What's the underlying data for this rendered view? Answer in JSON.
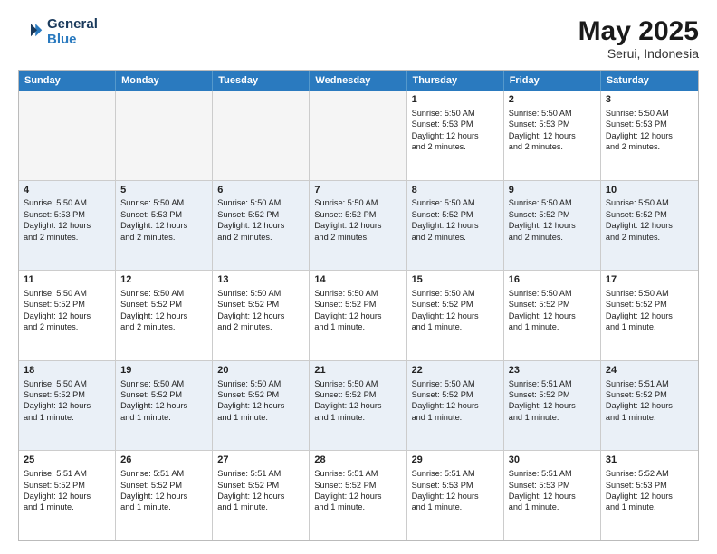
{
  "header": {
    "logo_line1": "General",
    "logo_line2": "Blue",
    "title": "May 2025",
    "subtitle": "Serui, Indonesia"
  },
  "days": [
    "Sunday",
    "Monday",
    "Tuesday",
    "Wednesday",
    "Thursday",
    "Friday",
    "Saturday"
  ],
  "weeks": [
    [
      {
        "day": "",
        "lines": []
      },
      {
        "day": "",
        "lines": []
      },
      {
        "day": "",
        "lines": []
      },
      {
        "day": "",
        "lines": []
      },
      {
        "day": "1",
        "lines": [
          "Sunrise: 5:50 AM",
          "Sunset: 5:53 PM",
          "Daylight: 12 hours",
          "and 2 minutes."
        ]
      },
      {
        "day": "2",
        "lines": [
          "Sunrise: 5:50 AM",
          "Sunset: 5:53 PM",
          "Daylight: 12 hours",
          "and 2 minutes."
        ]
      },
      {
        "day": "3",
        "lines": [
          "Sunrise: 5:50 AM",
          "Sunset: 5:53 PM",
          "Daylight: 12 hours",
          "and 2 minutes."
        ]
      }
    ],
    [
      {
        "day": "4",
        "lines": [
          "Sunrise: 5:50 AM",
          "Sunset: 5:53 PM",
          "Daylight: 12 hours",
          "and 2 minutes."
        ]
      },
      {
        "day": "5",
        "lines": [
          "Sunrise: 5:50 AM",
          "Sunset: 5:53 PM",
          "Daylight: 12 hours",
          "and 2 minutes."
        ]
      },
      {
        "day": "6",
        "lines": [
          "Sunrise: 5:50 AM",
          "Sunset: 5:52 PM",
          "Daylight: 12 hours",
          "and 2 minutes."
        ]
      },
      {
        "day": "7",
        "lines": [
          "Sunrise: 5:50 AM",
          "Sunset: 5:52 PM",
          "Daylight: 12 hours",
          "and 2 minutes."
        ]
      },
      {
        "day": "8",
        "lines": [
          "Sunrise: 5:50 AM",
          "Sunset: 5:52 PM",
          "Daylight: 12 hours",
          "and 2 minutes."
        ]
      },
      {
        "day": "9",
        "lines": [
          "Sunrise: 5:50 AM",
          "Sunset: 5:52 PM",
          "Daylight: 12 hours",
          "and 2 minutes."
        ]
      },
      {
        "day": "10",
        "lines": [
          "Sunrise: 5:50 AM",
          "Sunset: 5:52 PM",
          "Daylight: 12 hours",
          "and 2 minutes."
        ]
      }
    ],
    [
      {
        "day": "11",
        "lines": [
          "Sunrise: 5:50 AM",
          "Sunset: 5:52 PM",
          "Daylight: 12 hours",
          "and 2 minutes."
        ]
      },
      {
        "day": "12",
        "lines": [
          "Sunrise: 5:50 AM",
          "Sunset: 5:52 PM",
          "Daylight: 12 hours",
          "and 2 minutes."
        ]
      },
      {
        "day": "13",
        "lines": [
          "Sunrise: 5:50 AM",
          "Sunset: 5:52 PM",
          "Daylight: 12 hours",
          "and 2 minutes."
        ]
      },
      {
        "day": "14",
        "lines": [
          "Sunrise: 5:50 AM",
          "Sunset: 5:52 PM",
          "Daylight: 12 hours",
          "and 1 minute."
        ]
      },
      {
        "day": "15",
        "lines": [
          "Sunrise: 5:50 AM",
          "Sunset: 5:52 PM",
          "Daylight: 12 hours",
          "and 1 minute."
        ]
      },
      {
        "day": "16",
        "lines": [
          "Sunrise: 5:50 AM",
          "Sunset: 5:52 PM",
          "Daylight: 12 hours",
          "and 1 minute."
        ]
      },
      {
        "day": "17",
        "lines": [
          "Sunrise: 5:50 AM",
          "Sunset: 5:52 PM",
          "Daylight: 12 hours",
          "and 1 minute."
        ]
      }
    ],
    [
      {
        "day": "18",
        "lines": [
          "Sunrise: 5:50 AM",
          "Sunset: 5:52 PM",
          "Daylight: 12 hours",
          "and 1 minute."
        ]
      },
      {
        "day": "19",
        "lines": [
          "Sunrise: 5:50 AM",
          "Sunset: 5:52 PM",
          "Daylight: 12 hours",
          "and 1 minute."
        ]
      },
      {
        "day": "20",
        "lines": [
          "Sunrise: 5:50 AM",
          "Sunset: 5:52 PM",
          "Daylight: 12 hours",
          "and 1 minute."
        ]
      },
      {
        "day": "21",
        "lines": [
          "Sunrise: 5:50 AM",
          "Sunset: 5:52 PM",
          "Daylight: 12 hours",
          "and 1 minute."
        ]
      },
      {
        "day": "22",
        "lines": [
          "Sunrise: 5:50 AM",
          "Sunset: 5:52 PM",
          "Daylight: 12 hours",
          "and 1 minute."
        ]
      },
      {
        "day": "23",
        "lines": [
          "Sunrise: 5:51 AM",
          "Sunset: 5:52 PM",
          "Daylight: 12 hours",
          "and 1 minute."
        ]
      },
      {
        "day": "24",
        "lines": [
          "Sunrise: 5:51 AM",
          "Sunset: 5:52 PM",
          "Daylight: 12 hours",
          "and 1 minute."
        ]
      }
    ],
    [
      {
        "day": "25",
        "lines": [
          "Sunrise: 5:51 AM",
          "Sunset: 5:52 PM",
          "Daylight: 12 hours",
          "and 1 minute."
        ]
      },
      {
        "day": "26",
        "lines": [
          "Sunrise: 5:51 AM",
          "Sunset: 5:52 PM",
          "Daylight: 12 hours",
          "and 1 minute."
        ]
      },
      {
        "day": "27",
        "lines": [
          "Sunrise: 5:51 AM",
          "Sunset: 5:52 PM",
          "Daylight: 12 hours",
          "and 1 minute."
        ]
      },
      {
        "day": "28",
        "lines": [
          "Sunrise: 5:51 AM",
          "Sunset: 5:52 PM",
          "Daylight: 12 hours",
          "and 1 minute."
        ]
      },
      {
        "day": "29",
        "lines": [
          "Sunrise: 5:51 AM",
          "Sunset: 5:53 PM",
          "Daylight: 12 hours",
          "and 1 minute."
        ]
      },
      {
        "day": "30",
        "lines": [
          "Sunrise: 5:51 AM",
          "Sunset: 5:53 PM",
          "Daylight: 12 hours",
          "and 1 minute."
        ]
      },
      {
        "day": "31",
        "lines": [
          "Sunrise: 5:52 AM",
          "Sunset: 5:53 PM",
          "Daylight: 12 hours",
          "and 1 minute."
        ]
      }
    ]
  ]
}
